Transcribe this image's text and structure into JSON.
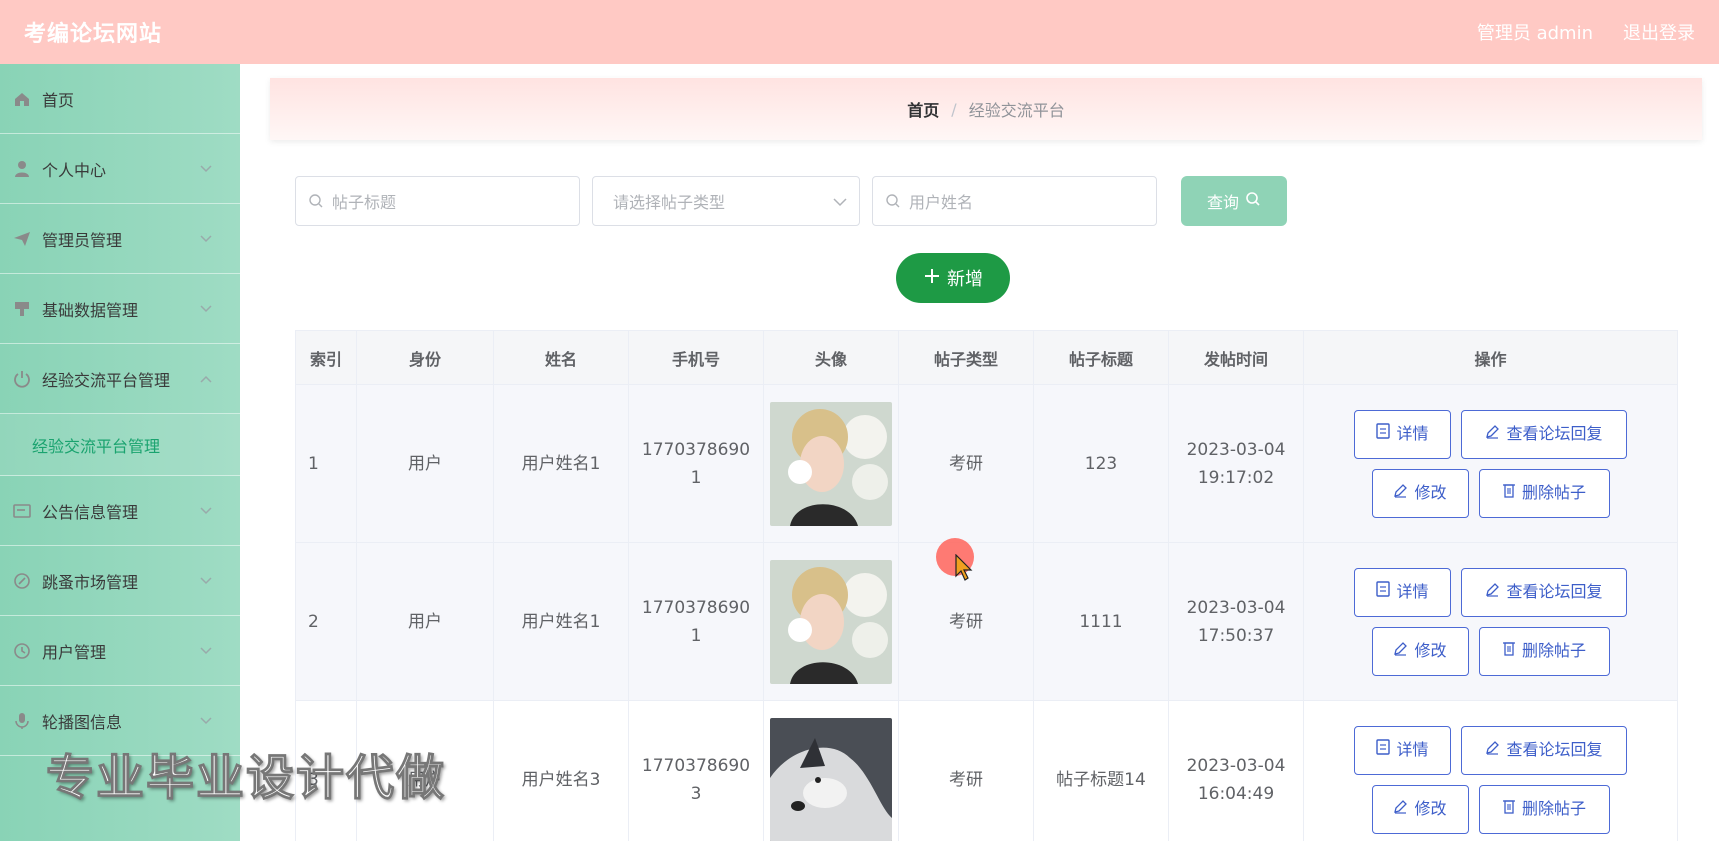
{
  "header": {
    "brand": "考编论坛网站",
    "admin_label": "管理员 admin",
    "logout": "退出登录"
  },
  "sidebar": {
    "items": [
      {
        "label": "首页",
        "icon": "home-icon"
      },
      {
        "label": "个人中心",
        "icon": "user-icon"
      },
      {
        "label": "管理员管理",
        "icon": "send-icon"
      },
      {
        "label": "基础数据管理",
        "icon": "stamp-icon"
      },
      {
        "label": "经验交流平台管理",
        "icon": "power-icon"
      },
      {
        "label": "公告信息管理",
        "icon": "notice-icon"
      },
      {
        "label": "跳蚤市场管理",
        "icon": "market-icon"
      },
      {
        "label": "用户管理",
        "icon": "clock-icon"
      },
      {
        "label": "轮播图信息",
        "icon": "mic-icon"
      }
    ],
    "active_sub": "经验交流平台管理"
  },
  "breadcrumb": {
    "home": "首页",
    "sep": "/",
    "current": "经验交流平台"
  },
  "search": {
    "title_placeholder": "帖子标题",
    "type_placeholder": "请选择帖子类型",
    "user_placeholder": "用户姓名",
    "query_label": "查询"
  },
  "add_label": "新增",
  "table": {
    "headers": [
      "索引",
      "身份",
      "姓名",
      "手机号",
      "头像",
      "帖子类型",
      "帖子标题",
      "发帖时间",
      "操作"
    ],
    "rows": [
      {
        "idx": "1",
        "role": "用户",
        "name": "用户姓名1",
        "phone_a": "1770378690",
        "phone_b": "1",
        "type": "考研",
        "title": "123",
        "date": "2023-03-04",
        "time": "19:17:02",
        "avatar": "portrait-with-flowers"
      },
      {
        "idx": "2",
        "role": "用户",
        "name": "用户姓名1",
        "phone_a": "1770378690",
        "phone_b": "1",
        "type": "考研",
        "title": "1111",
        "date": "2023-03-04",
        "time": "17:50:37",
        "avatar": "portrait-with-flowers"
      },
      {
        "idx": "3",
        "role": "用户",
        "name": "用户姓名3",
        "phone_a": "1770378690",
        "phone_b": "3",
        "type": "考研",
        "title": "帖子标题14",
        "date": "2023-03-04",
        "time": "16:04:49",
        "avatar": "husky-dog"
      }
    ],
    "ops": {
      "detail": "详情",
      "reply": "查看论坛回复",
      "edit": "修改",
      "delete": "删除帖子"
    }
  },
  "watermark": "专业毕业设计代做",
  "colors": {
    "header": "#ffc9c4",
    "sidebar": "#89d3b6",
    "accent": "#1aa36f",
    "add": "#1e9a45",
    "op_border": "#4d6ad6"
  }
}
